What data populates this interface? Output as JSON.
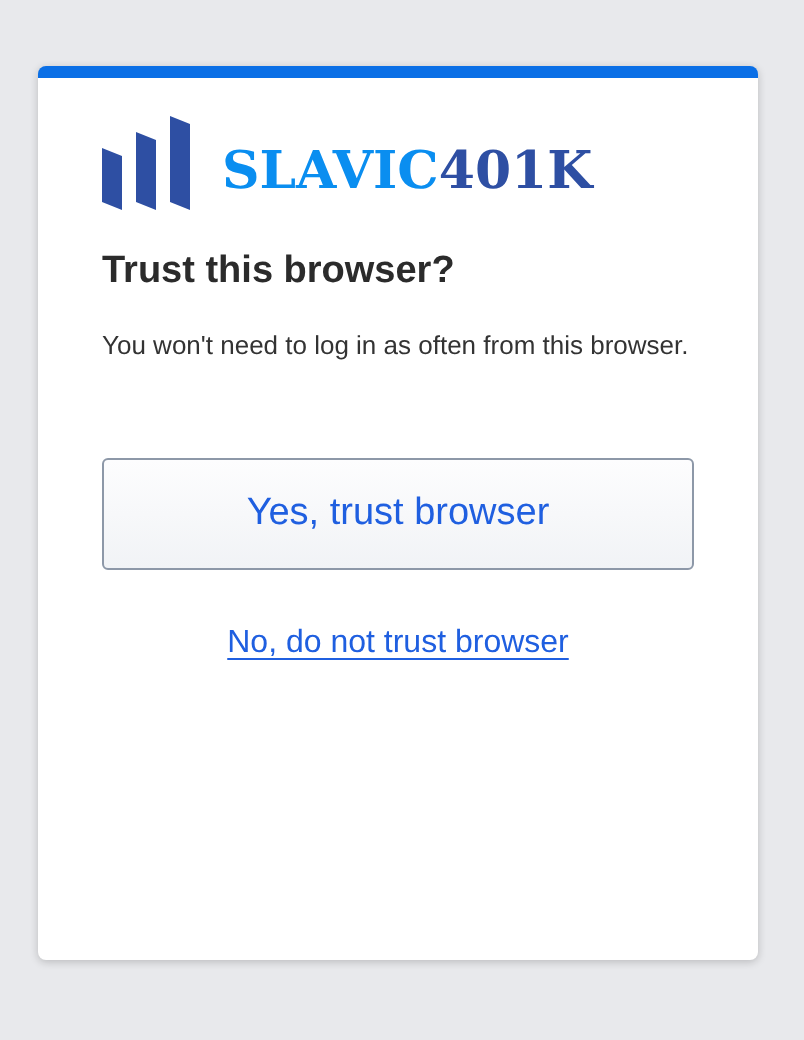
{
  "logo": {
    "name_first": "SLAVIC",
    "name_second": "401K"
  },
  "heading": "Trust this browser?",
  "message": "You won't need to log in as often from this browser.",
  "actions": [
    {
      "kind": "button",
      "label": "Yes, trust browser"
    },
    {
      "kind": "link",
      "label": "No, do not trust browser"
    }
  ]
}
